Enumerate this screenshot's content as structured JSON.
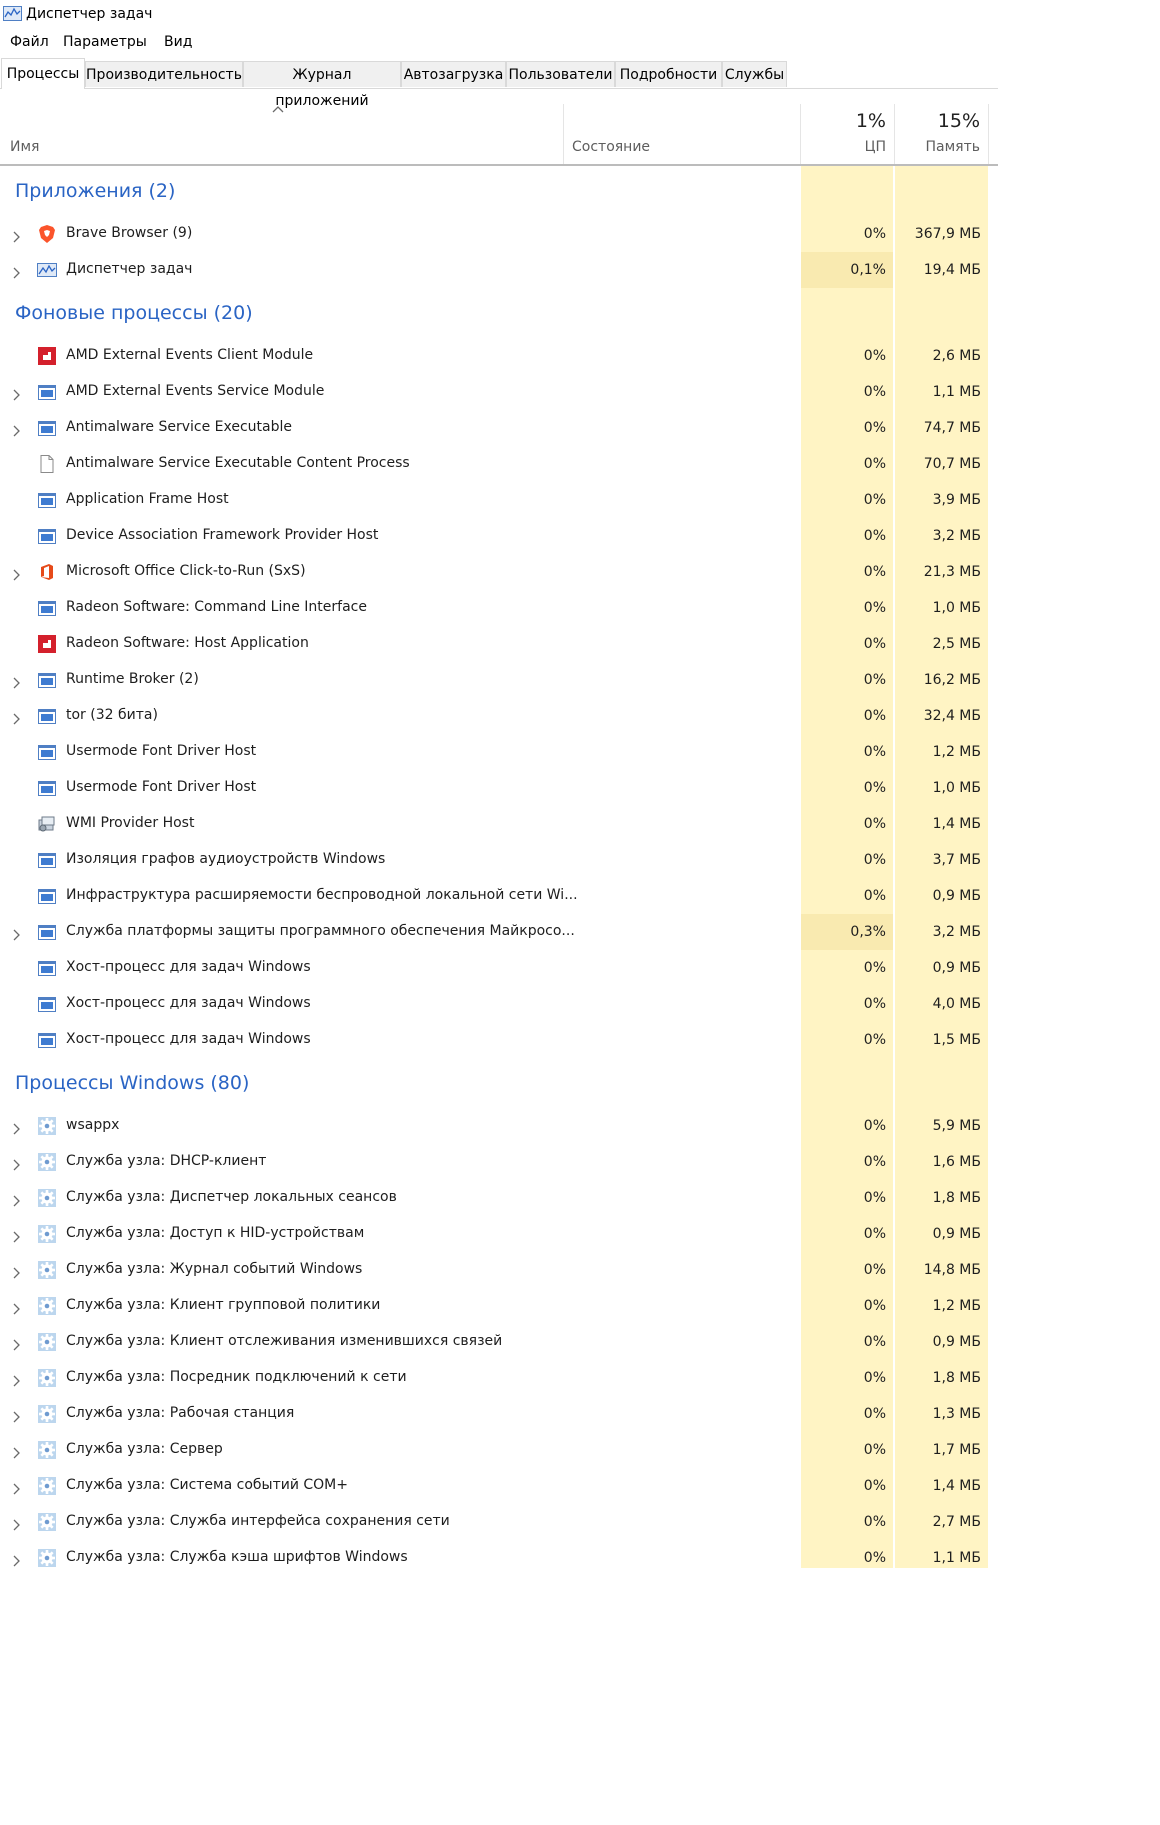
{
  "window": {
    "title": "Диспетчер задач"
  },
  "menu": [
    "Файл",
    "Параметры",
    "Вид"
  ],
  "tabs": [
    "Процессы",
    "Производительность",
    "Журнал приложений",
    "Автозагрузка",
    "Пользователи",
    "Подробности",
    "Службы"
  ],
  "active_tab": "Процессы",
  "header": {
    "name": "Имя",
    "state": "Состояние",
    "cpu_pct": "1%",
    "cpu": "ЦП",
    "mem_pct": "15%",
    "mem": "Память"
  },
  "colors": {
    "group_heading": "#2a64c4",
    "cell_highlight": "#fff4c4",
    "cell_hot": "#f9eab0"
  },
  "groups": [
    {
      "label": "Приложения (2)",
      "rows": [
        {
          "name": "Brave Browser (9)",
          "cpu": "0%",
          "mem": "367,9 МБ",
          "expandable": true,
          "icon": "brave-icon"
        },
        {
          "name": "Диспетчер задач",
          "cpu": "0,1%",
          "mem": "19,4 МБ",
          "expandable": true,
          "icon": "task-manager-icon",
          "hot": true
        }
      ]
    },
    {
      "label": "Фоновые процессы (20)",
      "rows": [
        {
          "name": "AMD External Events Client Module",
          "cpu": "0%",
          "mem": "2,6 МБ",
          "expandable": false,
          "icon": "amd-icon"
        },
        {
          "name": "AMD External Events Service Module",
          "cpu": "0%",
          "mem": "1,1 МБ",
          "expandable": true,
          "icon": "window-icon"
        },
        {
          "name": "Antimalware Service Executable",
          "cpu": "0%",
          "mem": "74,7 МБ",
          "expandable": true,
          "icon": "window-icon"
        },
        {
          "name": "Antimalware Service Executable Content Process",
          "cpu": "0%",
          "mem": "70,7 МБ",
          "expandable": false,
          "icon": "document-icon"
        },
        {
          "name": "Application Frame Host",
          "cpu": "0%",
          "mem": "3,9 МБ",
          "expandable": false,
          "icon": "window-icon"
        },
        {
          "name": "Device Association Framework Provider Host",
          "cpu": "0%",
          "mem": "3,2 МБ",
          "expandable": false,
          "icon": "window-icon"
        },
        {
          "name": "Microsoft Office Click-to-Run (SxS)",
          "cpu": "0%",
          "mem": "21,3 МБ",
          "expandable": true,
          "icon": "office-icon"
        },
        {
          "name": "Radeon Software: Command Line Interface",
          "cpu": "0%",
          "mem": "1,0 МБ",
          "expandable": false,
          "icon": "window-icon"
        },
        {
          "name": "Radeon Software: Host Application",
          "cpu": "0%",
          "mem": "2,5 МБ",
          "expandable": false,
          "icon": "amd-icon"
        },
        {
          "name": "Runtime Broker (2)",
          "cpu": "0%",
          "mem": "16,2 МБ",
          "expandable": true,
          "icon": "window-icon"
        },
        {
          "name": "tor (32 бита)",
          "cpu": "0%",
          "mem": "32,4 МБ",
          "expandable": true,
          "icon": "window-icon"
        },
        {
          "name": "Usermode Font Driver Host",
          "cpu": "0%",
          "mem": "1,2 МБ",
          "expandable": false,
          "icon": "window-icon"
        },
        {
          "name": "Usermode Font Driver Host",
          "cpu": "0%",
          "mem": "1,0 МБ",
          "expandable": false,
          "icon": "window-icon"
        },
        {
          "name": "WMI Provider Host",
          "cpu": "0%",
          "mem": "1,4 МБ",
          "expandable": false,
          "icon": "wmi-icon"
        },
        {
          "name": "Изоляция графов аудиоустройств Windows",
          "cpu": "0%",
          "mem": "3,7 МБ",
          "expandable": false,
          "icon": "window-icon"
        },
        {
          "name": "Инфраструктура расширяемости беспроводной локальной сети Wi...",
          "cpu": "0%",
          "mem": "0,9 МБ",
          "expandable": false,
          "icon": "window-icon"
        },
        {
          "name": "Служба платформы защиты программного обеспечения Майкросо...",
          "cpu": "0,3%",
          "mem": "3,2 МБ",
          "expandable": true,
          "icon": "window-icon",
          "hot": true
        },
        {
          "name": "Хост-процесс для задач Windows",
          "cpu": "0%",
          "mem": "0,9 МБ",
          "expandable": false,
          "icon": "window-icon"
        },
        {
          "name": "Хост-процесс для задач Windows",
          "cpu": "0%",
          "mem": "4,0 МБ",
          "expandable": false,
          "icon": "window-icon"
        },
        {
          "name": "Хост-процесс для задач Windows",
          "cpu": "0%",
          "mem": "1,5 МБ",
          "expandable": false,
          "icon": "window-icon"
        }
      ]
    },
    {
      "label": "Процессы Windows (80)",
      "rows": [
        {
          "name": "wsappx",
          "cpu": "0%",
          "mem": "5,9 МБ",
          "expandable": true,
          "icon": "gear-icon"
        },
        {
          "name": "Служба узла: DHCP-клиент",
          "cpu": "0%",
          "mem": "1,6 МБ",
          "expandable": true,
          "icon": "gear-icon"
        },
        {
          "name": "Служба узла: Диспетчер локальных сеансов",
          "cpu": "0%",
          "mem": "1,8 МБ",
          "expandable": true,
          "icon": "gear-icon"
        },
        {
          "name": "Служба узла: Доступ к HID-устройствам",
          "cpu": "0%",
          "mem": "0,9 МБ",
          "expandable": true,
          "icon": "gear-icon"
        },
        {
          "name": "Служба узла: Журнал событий Windows",
          "cpu": "0%",
          "mem": "14,8 МБ",
          "expandable": true,
          "icon": "gear-icon"
        },
        {
          "name": "Служба узла: Клиент групповой политики",
          "cpu": "0%",
          "mem": "1,2 МБ",
          "expandable": true,
          "icon": "gear-icon"
        },
        {
          "name": "Служба узла: Клиент отслеживания изменившихся связей",
          "cpu": "0%",
          "mem": "0,9 МБ",
          "expandable": true,
          "icon": "gear-icon"
        },
        {
          "name": "Служба узла: Посредник подключений к сети",
          "cpu": "0%",
          "mem": "1,8 МБ",
          "expandable": true,
          "icon": "gear-icon"
        },
        {
          "name": "Служба узла: Рабочая станция",
          "cpu": "0%",
          "mem": "1,3 МБ",
          "expandable": true,
          "icon": "gear-icon"
        },
        {
          "name": "Служба узла: Сервер",
          "cpu": "0%",
          "mem": "1,7 МБ",
          "expandable": true,
          "icon": "gear-icon"
        },
        {
          "name": "Служба узла: Система событий COM+",
          "cpu": "0%",
          "mem": "1,4 МБ",
          "expandable": true,
          "icon": "gear-icon"
        },
        {
          "name": "Служба узла: Служба интерфейса сохранения сети",
          "cpu": "0%",
          "mem": "2,7 МБ",
          "expandable": true,
          "icon": "gear-icon"
        },
        {
          "name": "Служба узла: Служба кэша шрифтов Windows",
          "cpu": "0%",
          "mem": "1,1 МБ",
          "expandable": true,
          "icon": "gear-icon"
        }
      ]
    }
  ]
}
